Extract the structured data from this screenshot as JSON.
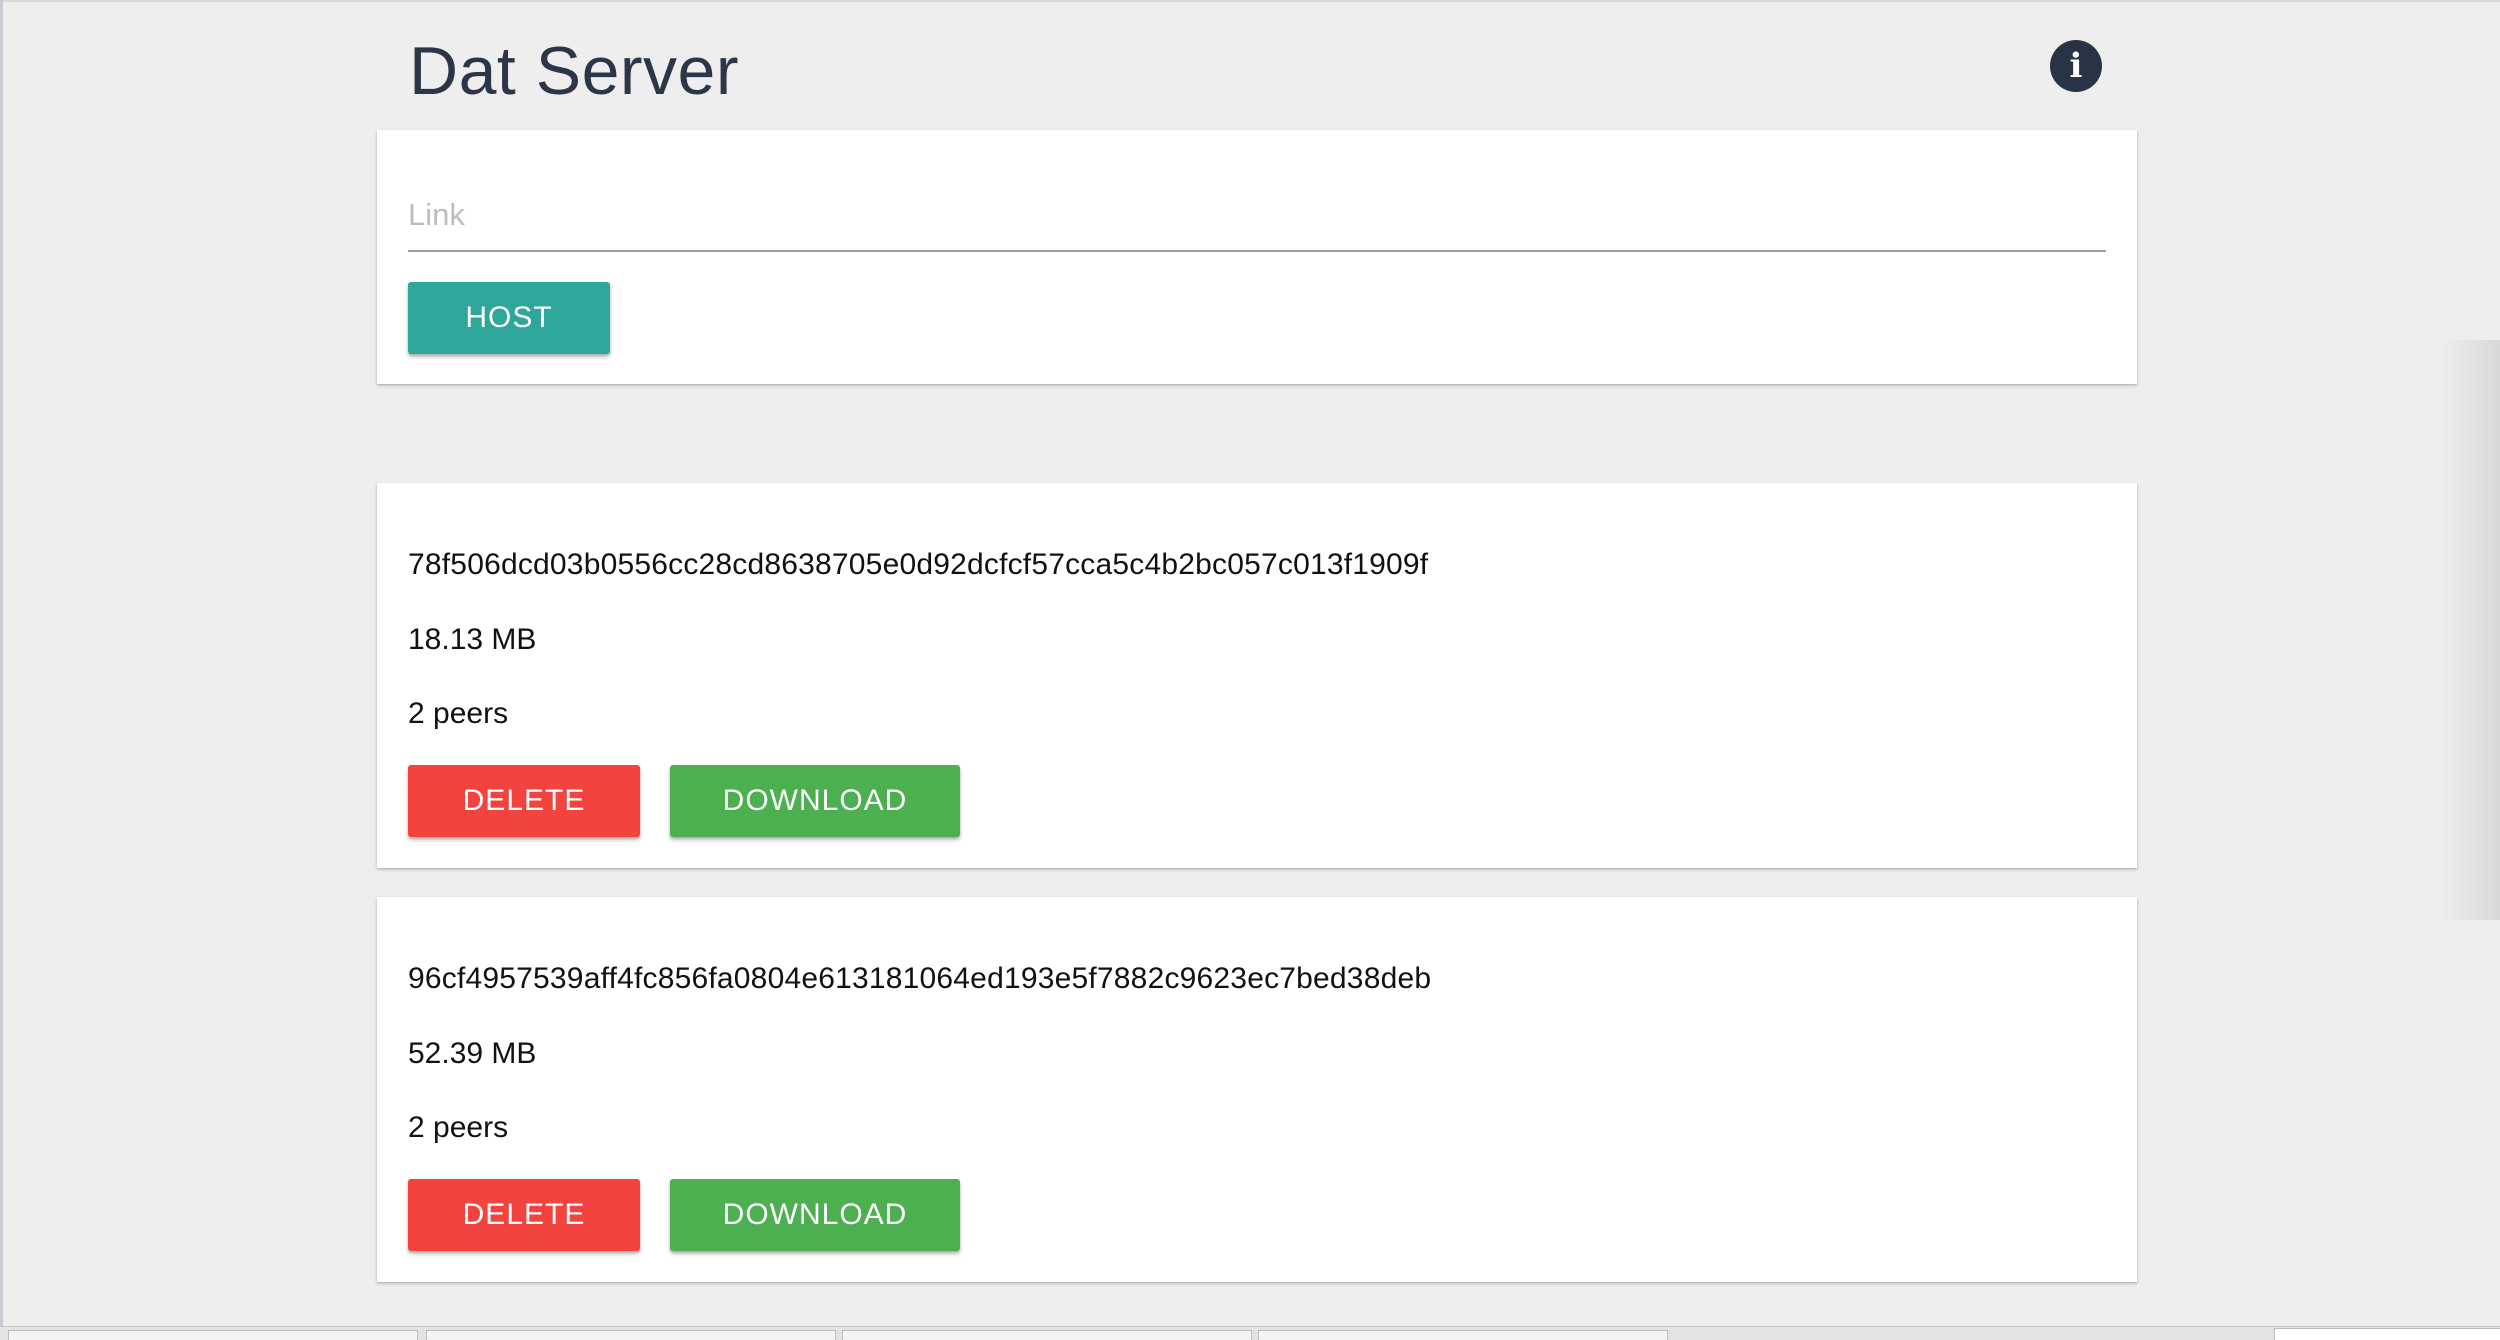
{
  "header": {
    "title": "Dat Server",
    "info_icon": "info-circle-icon",
    "info_glyph": "i"
  },
  "host_form": {
    "link_placeholder": "Link",
    "link_value": "",
    "host_label": "HOST"
  },
  "archives": [
    {
      "key": "78f506dcd03b0556cc28cd8638705e0d92dcfcf57cca5c4b2bc057c013f1909f",
      "size": "18.13 MB",
      "peers": "2 peers",
      "delete_label": "DELETE",
      "download_label": "DOWNLOAD"
    },
    {
      "key": "96cf4957539aff4fc856fa0804e613181064ed193e5f7882c9623ec7bed38deb",
      "size": "52.39 MB",
      "peers": "2 peers",
      "delete_label": "DELETE",
      "download_label": "DOWNLOAD"
    }
  ],
  "colors": {
    "host_button": "#2ea69a",
    "delete_button": "#f2433e",
    "download_button": "#4caf50",
    "title": "#2b3648",
    "background": "#eeeeee"
  }
}
